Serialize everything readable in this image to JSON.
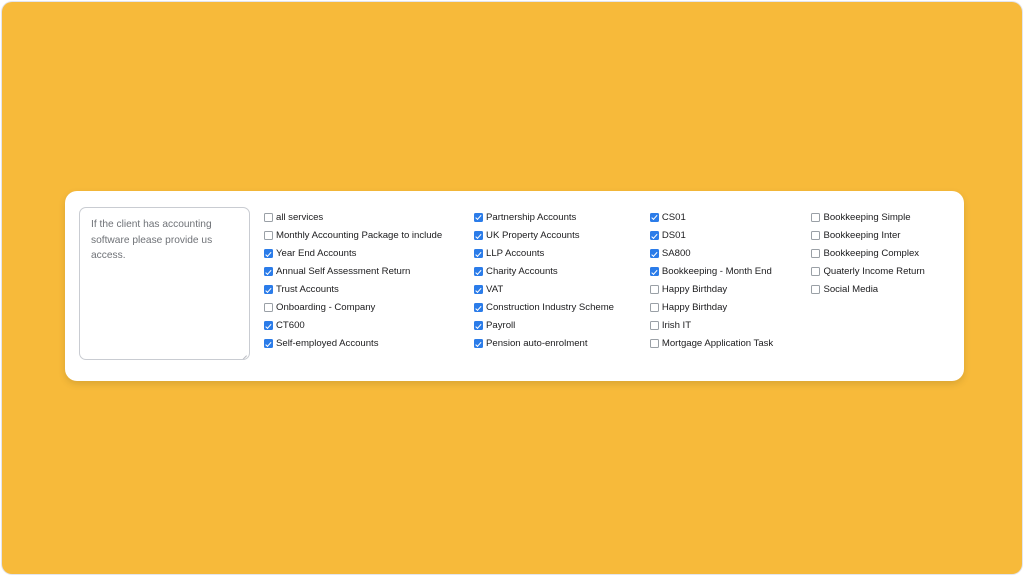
{
  "theme": {
    "page_background": "#F7BA3A",
    "card_background": "#FFFFFF",
    "checkbox_checked_color": "#2B7CE9",
    "checkbox_border_color": "#9AA0A6",
    "label_color": "#1C1C1E",
    "notes_text_color": "#6F7277"
  },
  "notes": {
    "value": "If the client has accounting software please provide us access.",
    "placeholder": "If the client has accounting software please provide us access."
  },
  "columns": [
    {
      "name": "services-column-1",
      "items": [
        {
          "label": "all services",
          "checked": false
        },
        {
          "label": "Monthly Accounting Package to include",
          "checked": false
        },
        {
          "label": "Year End Accounts",
          "checked": true
        },
        {
          "label": "Annual Self Assessment Return",
          "checked": true
        },
        {
          "label": "Trust Accounts",
          "checked": true
        },
        {
          "label": "Onboarding - Company",
          "checked": false
        },
        {
          "label": "CT600",
          "checked": true
        },
        {
          "label": "Self-employed Accounts",
          "checked": true
        }
      ]
    },
    {
      "name": "services-column-2",
      "items": [
        {
          "label": "Partnership Accounts",
          "checked": true
        },
        {
          "label": "UK Property Accounts",
          "checked": true
        },
        {
          "label": "LLP Accounts",
          "checked": true
        },
        {
          "label": "Charity Accounts",
          "checked": true
        },
        {
          "label": "VAT",
          "checked": true
        },
        {
          "label": "Construction Industry Scheme",
          "checked": true
        },
        {
          "label": "Payroll",
          "checked": true
        },
        {
          "label": "Pension auto-enrolment",
          "checked": true
        }
      ]
    },
    {
      "name": "services-column-3",
      "items": [
        {
          "label": "CS01",
          "checked": true
        },
        {
          "label": "DS01",
          "checked": true
        },
        {
          "label": "SA800",
          "checked": true
        },
        {
          "label": "Bookkeeping - Month End",
          "checked": true
        },
        {
          "label": "Happy Birthday",
          "checked": false
        },
        {
          "label": "Happy Birthday",
          "checked": false
        },
        {
          "label": "Irish IT",
          "checked": false
        },
        {
          "label": "Mortgage Application Task",
          "checked": false
        }
      ]
    },
    {
      "name": "services-column-4",
      "items": [
        {
          "label": "Bookkeeping Simple",
          "checked": false
        },
        {
          "label": "Bookkeeping Inter",
          "checked": false
        },
        {
          "label": "Bookkeeping Complex",
          "checked": false
        },
        {
          "label": "Quaterly Income Return",
          "checked": false
        },
        {
          "label": "Social Media",
          "checked": false
        }
      ]
    }
  ]
}
